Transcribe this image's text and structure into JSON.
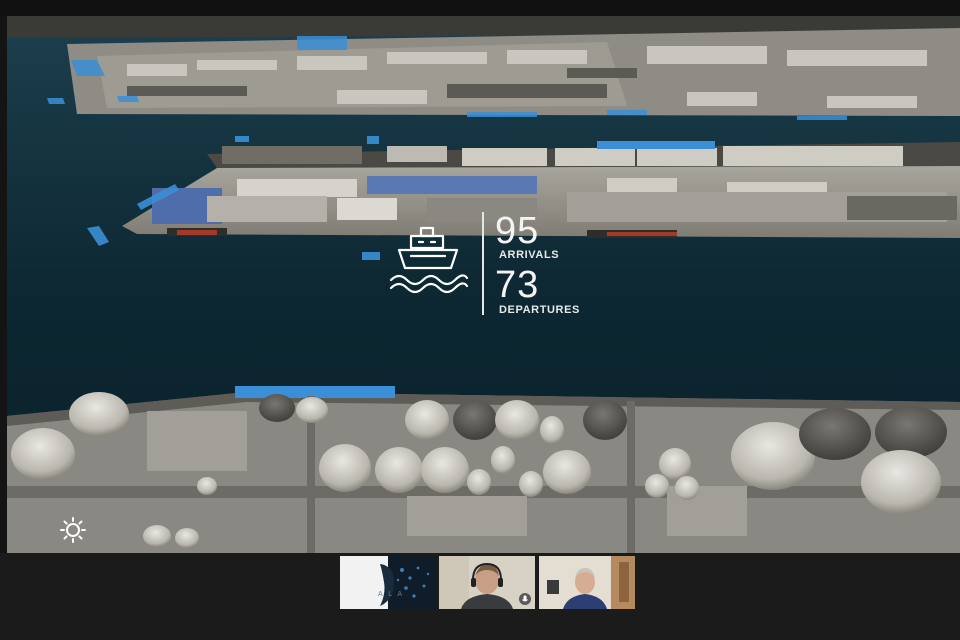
{
  "app": {
    "name": "Video meeting",
    "view": "screen-share"
  },
  "shared_screen": {
    "scene": "Aerial 3D port terminal visualization",
    "stats": [
      {
        "value": "95",
        "label": "ARRIVALS"
      },
      {
        "value": "73",
        "label": "DEPARTURES"
      }
    ],
    "icons": {
      "ship": "ship-icon",
      "brightness": "sun-icon"
    }
  },
  "participants": [
    {
      "id": "p1",
      "video": "logo-avatar",
      "logo_text": "A  L  A"
    },
    {
      "id": "p2",
      "video": "camera",
      "icon": "mic-icon"
    },
    {
      "id": "p3",
      "video": "camera"
    }
  ],
  "colors": {
    "water": "#0c2733",
    "highlight": "#3b8fd6",
    "overlay_text": "#f4f4f4",
    "meeting_bg": "#1b1b1b"
  }
}
